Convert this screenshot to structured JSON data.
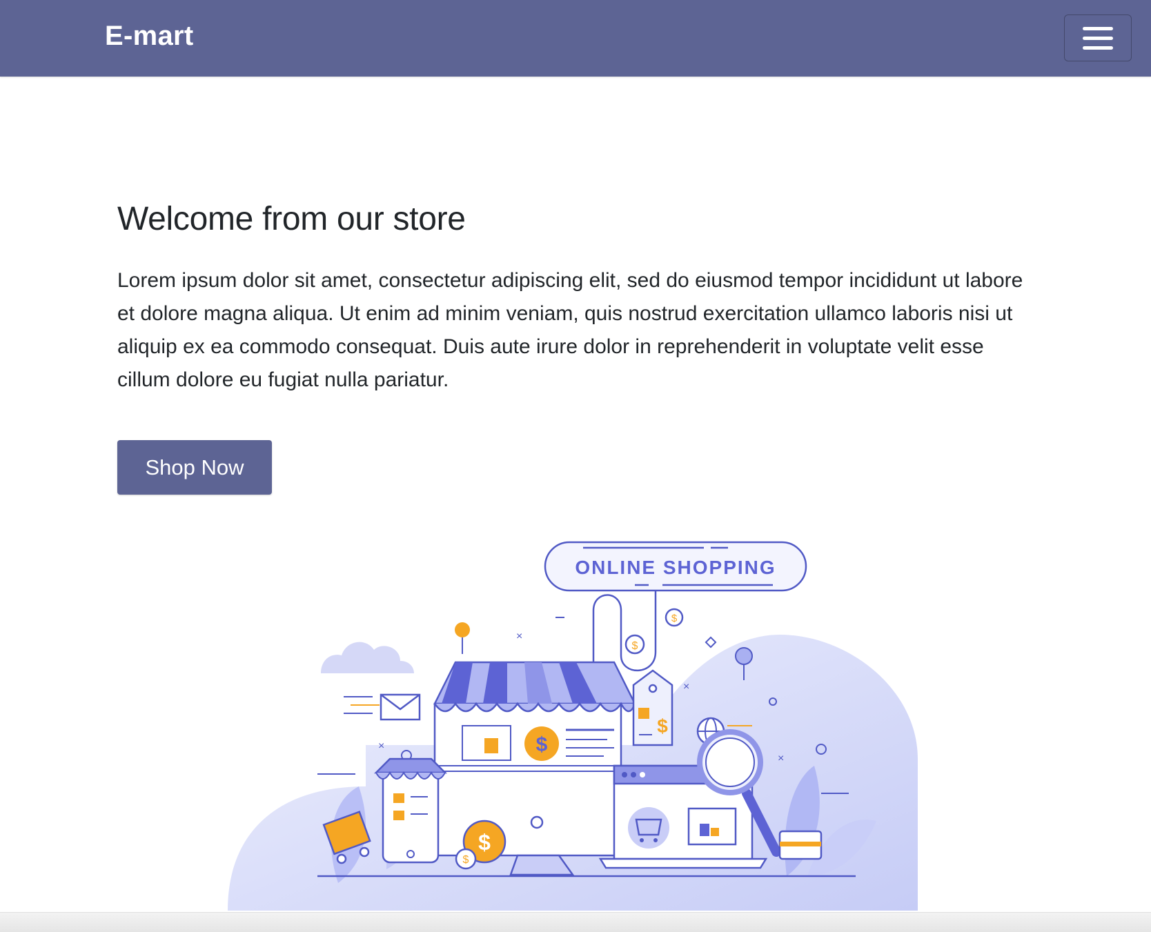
{
  "navbar": {
    "brand": "E-mart",
    "menu_icon": "hamburger-menu-icon",
    "bg_color": "#5d6494"
  },
  "hero": {
    "title": "Welcome from our store",
    "text": "Lorem ipsum dolor sit amet, consectetur adipiscing elit, sed do eiusmod tempor incididunt ut labore et dolore magna aliqua. Ut enim ad minim veniam, quis nostrud exercitation ullamco laboris nisi ut aliquip ex ea commodo consequat. Duis aute irure dolor in reprehenderit in voluptate velit esse cillum dolore eu fugiat nulla pariatur.",
    "button_label": "Shop Now"
  },
  "illustration": {
    "banner_text": "ONLINE SHOPPING",
    "accent": "#6b70d6",
    "highlight": "#f5a623"
  }
}
